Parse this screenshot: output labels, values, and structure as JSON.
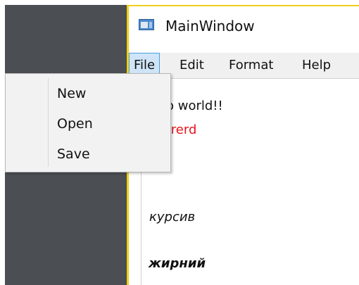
{
  "window": {
    "title": "MainWindow",
    "icon": "app-window-icon"
  },
  "menubar": {
    "items": [
      {
        "label": "File",
        "active": true
      },
      {
        "label": "Edit"
      },
      {
        "label": "Format"
      },
      {
        "label": "Help"
      }
    ]
  },
  "file_menu": {
    "items": [
      {
        "label": "New"
      },
      {
        "label": "Open"
      },
      {
        "label": "Save"
      }
    ]
  },
  "editor": {
    "lines": [
      {
        "text": "llo world!!",
        "color": "#111111",
        "style": "normal"
      },
      {
        "text": "t rerd",
        "color": "#e8131c",
        "style": "normal"
      },
      {
        "text": "курсив",
        "color": "#111111",
        "style": "italic"
      },
      {
        "text": "жирний",
        "color": "#111111",
        "style": "bold-italic"
      }
    ]
  },
  "colors": {
    "desktop": "#4b4e52",
    "window_focus_border": "#f0cf1b",
    "menu_active_bg": "#cfe5f7",
    "menu_active_border": "#47a0e0",
    "red_text": "#e8131c"
  }
}
